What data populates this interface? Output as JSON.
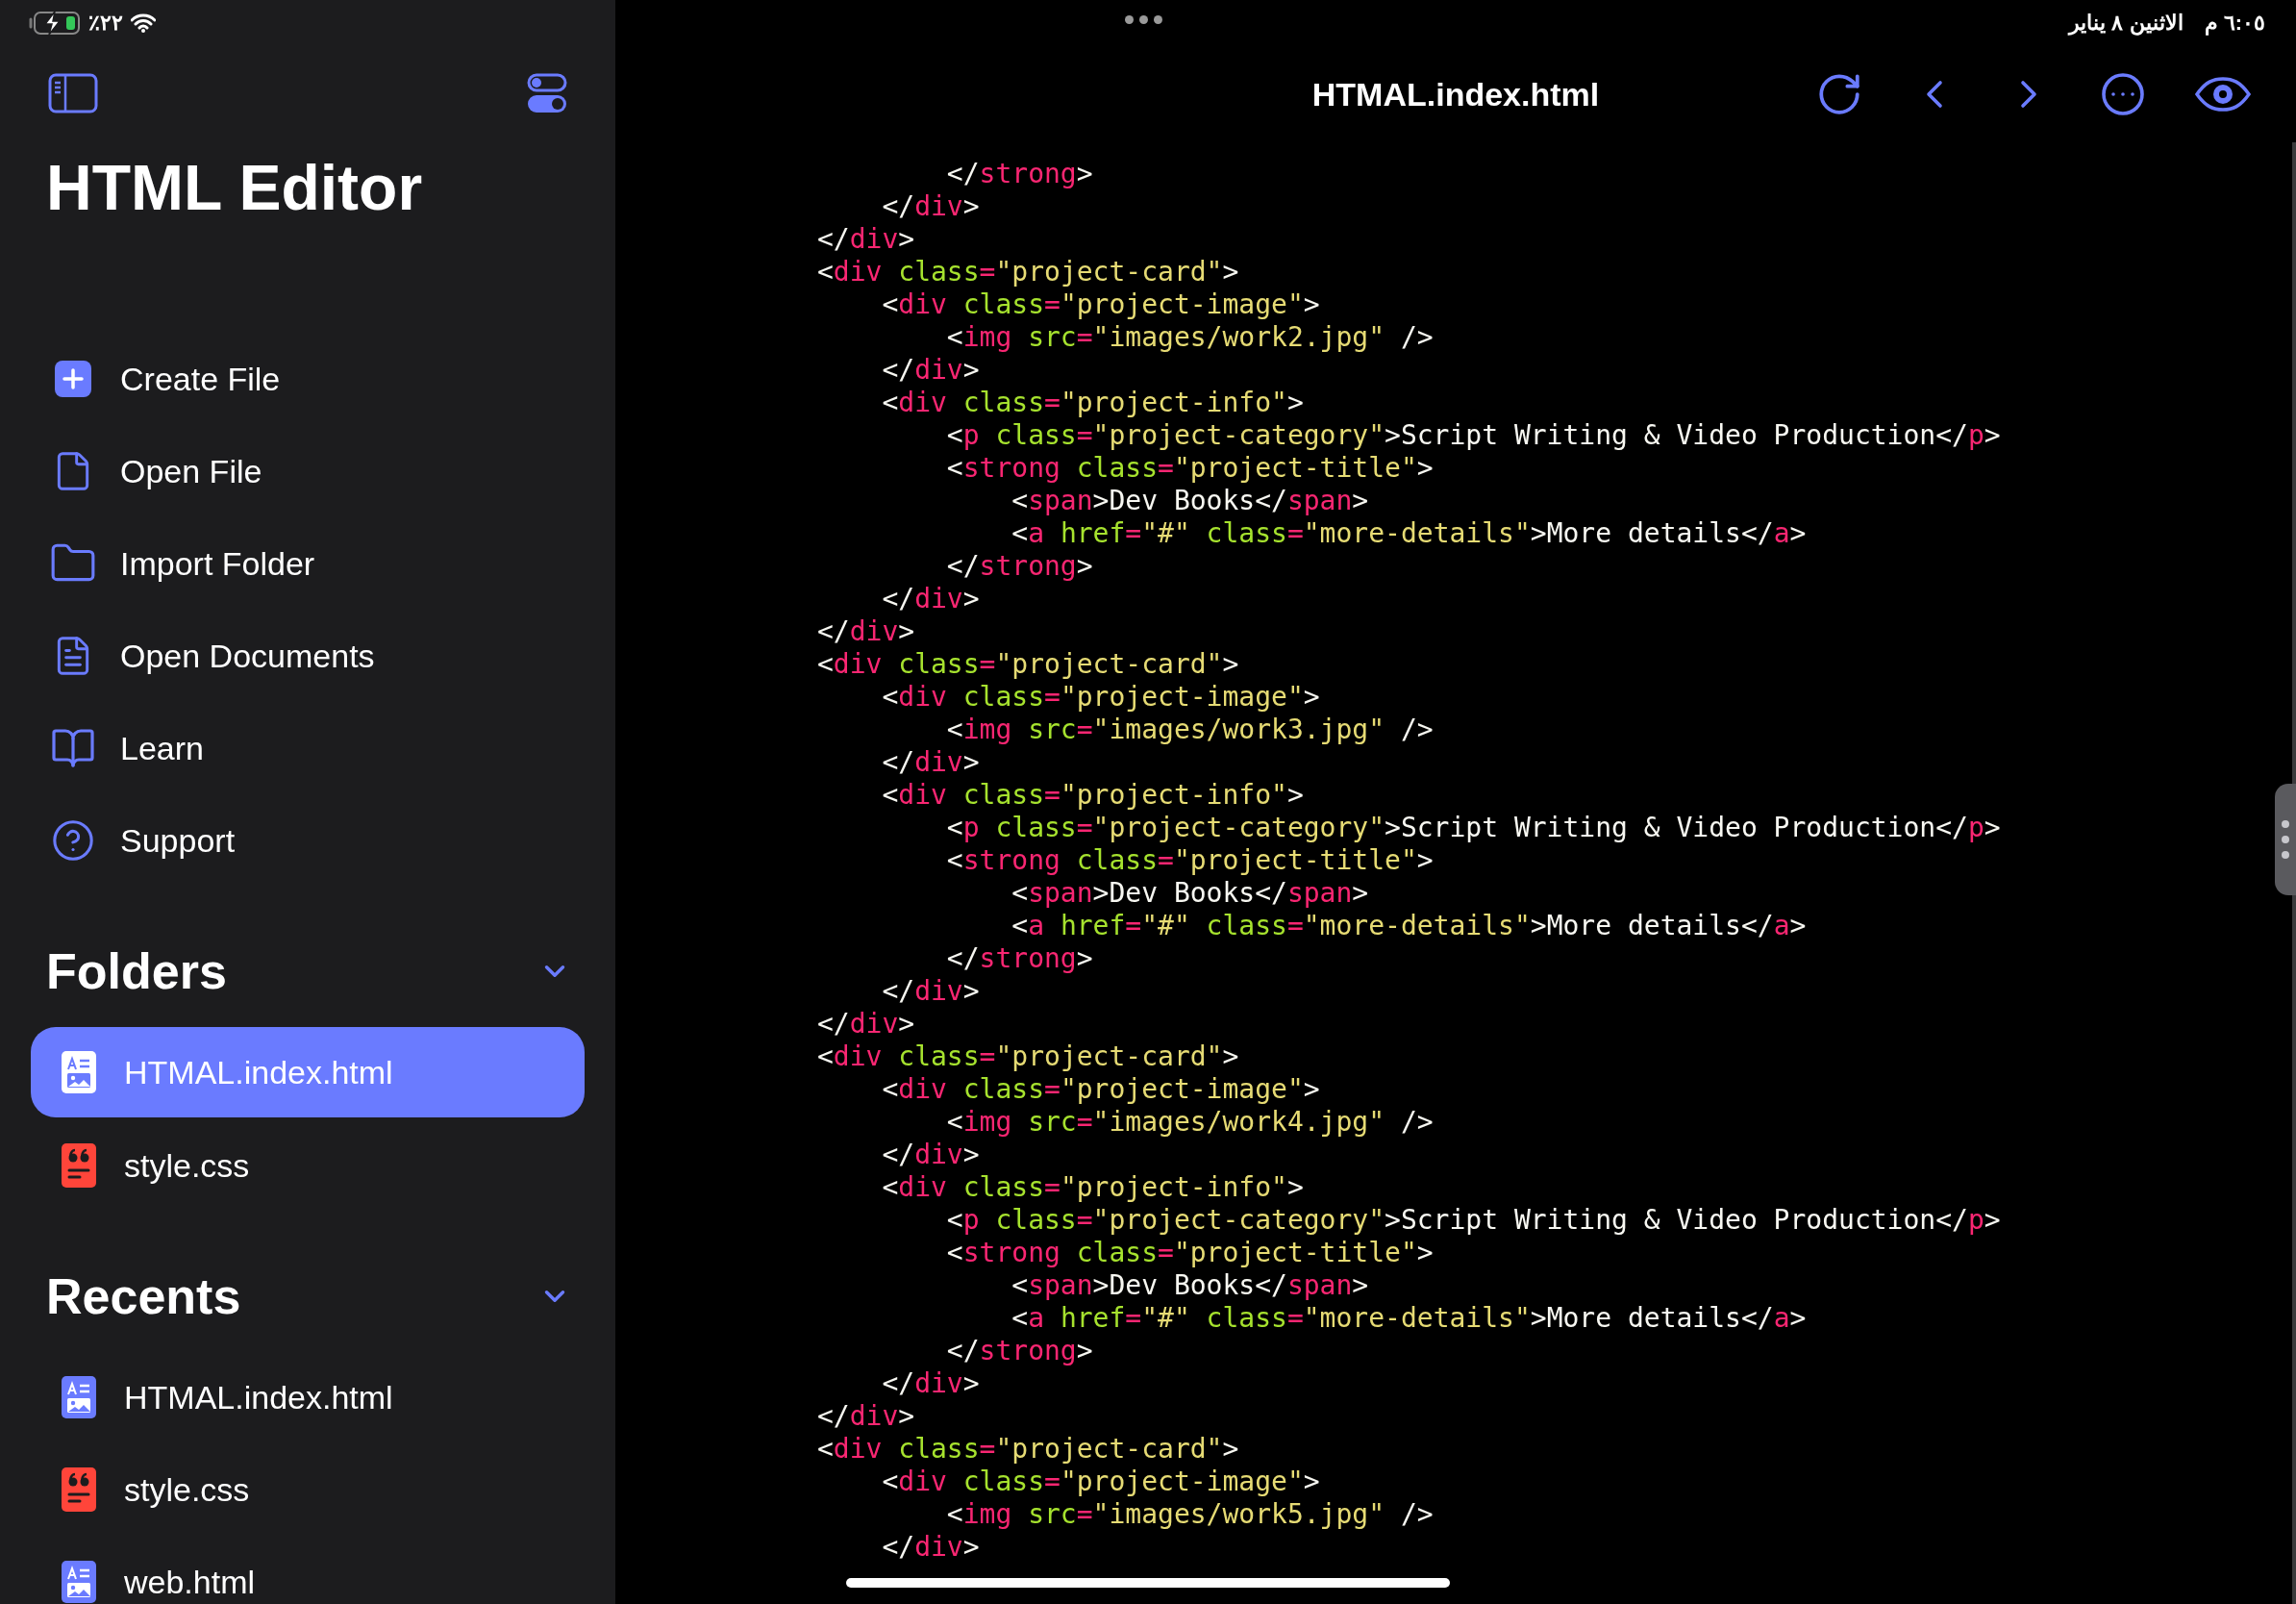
{
  "status_bar": {
    "battery": "٢٢٪",
    "time": "٦:٠٥ م",
    "date": "الاثنين ٨ يناير"
  },
  "sidebar": {
    "title": "HTML Editor",
    "menu": [
      {
        "label": "Create File"
      },
      {
        "label": "Open File"
      },
      {
        "label": "Import Folder"
      },
      {
        "label": "Open Documents"
      },
      {
        "label": "Learn"
      },
      {
        "label": "Support"
      }
    ],
    "folders": {
      "title": "Folders",
      "expanded": true,
      "items": [
        {
          "name": "HTMAL.index.html",
          "kind": "html",
          "selected": true
        },
        {
          "name": "style.css",
          "kind": "css",
          "selected": false
        }
      ]
    },
    "recents": {
      "title": "Recents",
      "expanded": true,
      "items": [
        {
          "name": "HTMAL.index.html",
          "kind": "html",
          "selected": false
        },
        {
          "name": "style.css",
          "kind": "css",
          "selected": false
        },
        {
          "name": "web.html",
          "kind": "html",
          "selected": false
        }
      ]
    }
  },
  "editor": {
    "title": "HTMAL.index.html",
    "lines": [
      "        </strong>",
      "    </div>",
      "</div>",
      "<div class=\"project-card\">",
      "    <div class=\"project-image\">",
      "        <img src=\"images/work2.jpg\" />",
      "    </div>",
      "    <div class=\"project-info\">",
      "        <p class=\"project-category\">Script Writing & Video Production</p>",
      "        <strong class=\"project-title\">",
      "            <span>Dev Books</span>",
      "            <a href=\"#\" class=\"more-details\">More details</a>",
      "        </strong>",
      "    </div>",
      "</div>",
      "<div class=\"project-card\">",
      "    <div class=\"project-image\">",
      "        <img src=\"images/work3.jpg\" />",
      "    </div>",
      "    <div class=\"project-info\">",
      "        <p class=\"project-category\">Script Writing & Video Production</p>",
      "        <strong class=\"project-title\">",
      "            <span>Dev Books</span>",
      "            <a href=\"#\" class=\"more-details\">More details</a>",
      "        </strong>",
      "    </div>",
      "</div>",
      "<div class=\"project-card\">",
      "    <div class=\"project-image\">",
      "        <img src=\"images/work4.jpg\" />",
      "    </div>",
      "    <div class=\"project-info\">",
      "        <p class=\"project-category\">Script Writing & Video Production</p>",
      "        <strong class=\"project-title\">",
      "            <span>Dev Books</span>",
      "            <a href=\"#\" class=\"more-details\">More details</a>",
      "        </strong>",
      "    </div>",
      "</div>",
      "<div class=\"project-card\">",
      "    <div class=\"project-image\">",
      "        <img src=\"images/work5.jpg\" />",
      "    </div>"
    ]
  }
}
